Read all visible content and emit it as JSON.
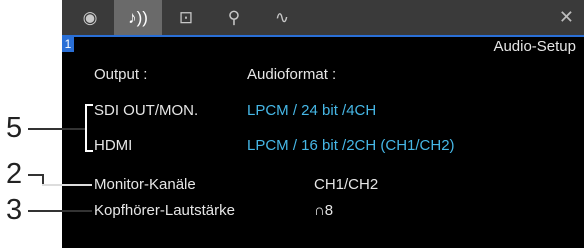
{
  "tabs": [
    {
      "icon": "camera-reel-icon",
      "glyph": "◉"
    },
    {
      "icon": "audio-icon",
      "glyph": "♪))"
    },
    {
      "icon": "recording-settings-icon",
      "glyph": "⊡"
    },
    {
      "icon": "wrench-icon",
      "glyph": "⚲"
    },
    {
      "icon": "system-wave-icon",
      "glyph": "∿"
    }
  ],
  "close_glyph": "✕",
  "page_number": "1",
  "title": "Audio-Setup",
  "headers": {
    "output": "Output :",
    "format": "Audioformat :"
  },
  "rows": {
    "sdi": {
      "label": "SDI OUT/MON.",
      "value": "LPCM / 24 bit /4CH"
    },
    "hdmi": {
      "label": "HDMI",
      "value": "LPCM / 16 bit /2CH (CH1/CH2)"
    },
    "monitor": {
      "label": "Monitor-Kanäle",
      "value": "CH1/CH2"
    },
    "headphone": {
      "label": "Kopfhörer-Lautstärke",
      "value": "8"
    }
  },
  "headphone_glyph": "∩",
  "callouts": {
    "five": "5",
    "two": "2",
    "three": "3"
  }
}
